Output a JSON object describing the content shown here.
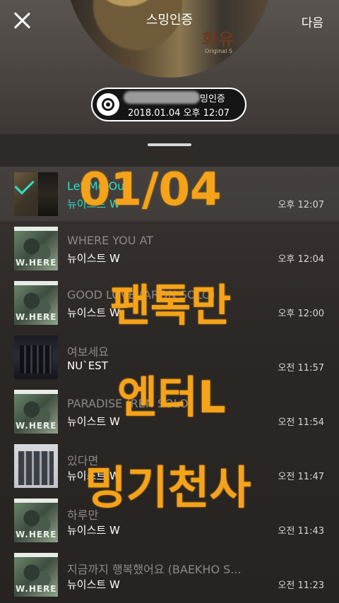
{
  "header": {
    "title": "스밍인증",
    "next_label": "다음",
    "album_text": "화유",
    "album_sub": "Original S"
  },
  "badge": {
    "label": "밍인증",
    "datetime": "2018.01.04 오후 12:07"
  },
  "songs": [
    {
      "title": "Let Me Out",
      "artist": "뉴이스트 W",
      "time": "오후 12:07",
      "selected": true
    },
    {
      "title": "WHERE YOU AT",
      "artist": "뉴이스트 W",
      "time": "오후 12:04"
    },
    {
      "title": "GOOD LOVE (ARON SOLO)",
      "artist": "뉴이스트 W",
      "time": "오후 12:00"
    },
    {
      "title": "여보세요",
      "artist": "NU`EST",
      "time": "오전 11:57"
    },
    {
      "title": "PARADISE (REN SOLO)",
      "artist": "뉴이스트 W",
      "time": "오전 11:54"
    },
    {
      "title": "있다면",
      "artist": "뉴이스트 W",
      "time": "오전 11:47"
    },
    {
      "title": "하루만",
      "artist": "뉴이스트 W",
      "time": "오전 11:43"
    },
    {
      "title": "지금까지 행복했어요 (BAEKHO S...",
      "artist": "뉴이스트 W",
      "time": "오전 11:23"
    }
  ],
  "album_label": "W.HERE",
  "overlay": {
    "date": "01/04",
    "line1": "팬톡만",
    "line2": "엔터L",
    "line3": "밍기천사",
    "color": "#f5a31a"
  },
  "colors": {
    "accent": "#2fe0c5"
  }
}
